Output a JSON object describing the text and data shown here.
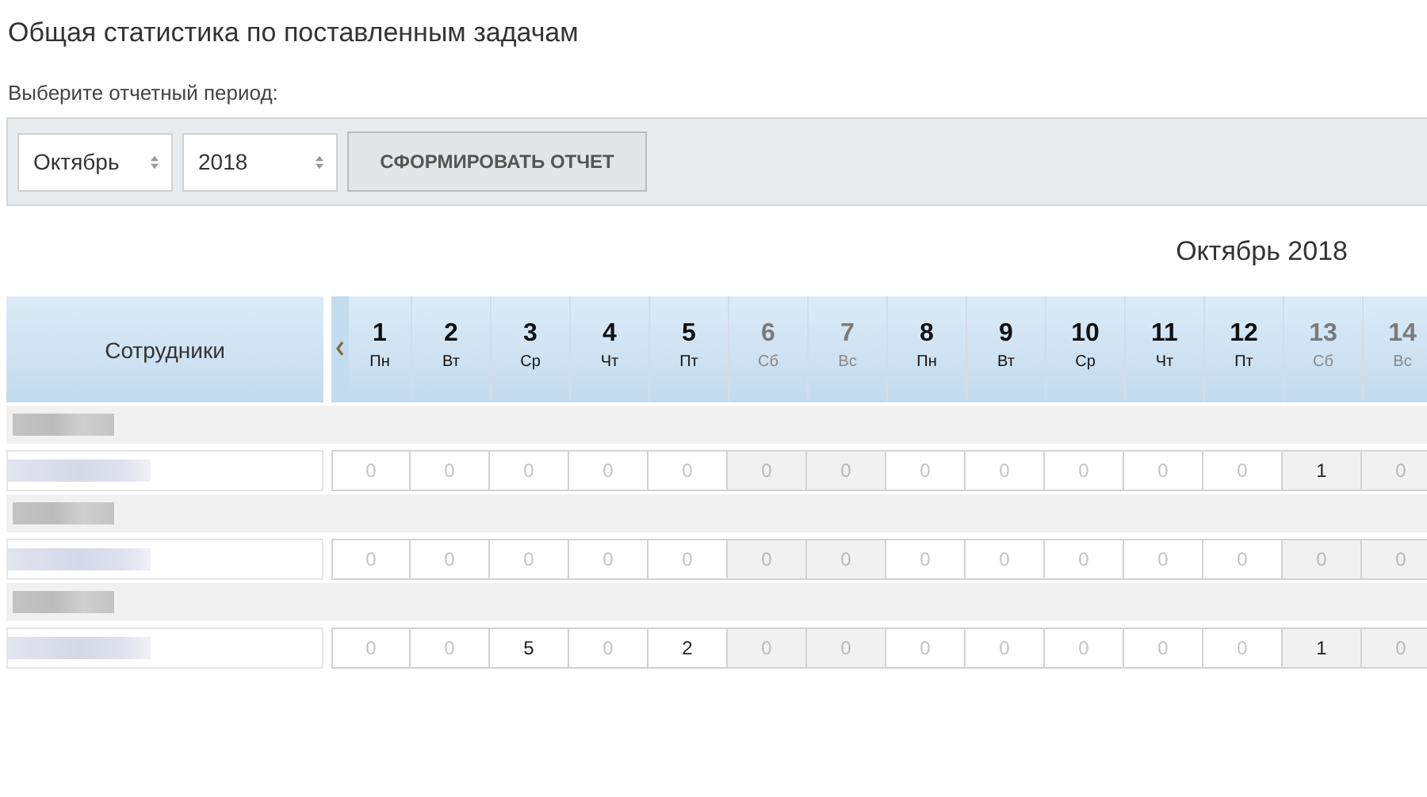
{
  "title": "Общая статистика по поставленным задачам",
  "period_label": "Выберите отчетный период:",
  "filters": {
    "month": {
      "value": "Октябрь"
    },
    "year": {
      "value": "2018"
    },
    "button": "СФОРМИРОВАТЬ ОТЧЕТ"
  },
  "caption": "Октябрь 2018",
  "table": {
    "employee_column": "Сотрудники",
    "days": [
      {
        "number": "1",
        "weekday": "Пн",
        "weekend": false
      },
      {
        "number": "2",
        "weekday": "Вт",
        "weekend": false
      },
      {
        "number": "3",
        "weekday": "Ср",
        "weekend": false
      },
      {
        "number": "4",
        "weekday": "Чт",
        "weekend": false
      },
      {
        "number": "5",
        "weekday": "Пт",
        "weekend": false
      },
      {
        "number": "6",
        "weekday": "Сб",
        "weekend": true
      },
      {
        "number": "7",
        "weekday": "Вс",
        "weekend": true
      },
      {
        "number": "8",
        "weekday": "Пн",
        "weekend": false
      },
      {
        "number": "9",
        "weekday": "Вт",
        "weekend": false
      },
      {
        "number": "10",
        "weekday": "Ср",
        "weekend": false
      },
      {
        "number": "11",
        "weekday": "Чт",
        "weekend": false
      },
      {
        "number": "12",
        "weekday": "Пт",
        "weekend": false
      },
      {
        "number": "13",
        "weekday": "Сб",
        "weekend": true
      },
      {
        "number": "14",
        "weekday": "Вс",
        "weekend": true
      }
    ],
    "rows": [
      {
        "cells": [
          {
            "value": "0",
            "muted": true
          },
          {
            "value": "0",
            "muted": true
          },
          {
            "value": "0",
            "muted": true
          },
          {
            "value": "0",
            "muted": true
          },
          {
            "value": "0",
            "muted": true
          },
          {
            "value": "0",
            "muted": true
          },
          {
            "value": "0",
            "muted": true
          },
          {
            "value": "0",
            "muted": true
          },
          {
            "value": "0",
            "muted": true
          },
          {
            "value": "0",
            "muted": true
          },
          {
            "value": "0",
            "muted": true
          },
          {
            "value": "0",
            "muted": true
          },
          {
            "value": "1",
            "muted": false
          },
          {
            "value": "0",
            "muted": true
          }
        ]
      },
      {
        "cells": [
          {
            "value": "0",
            "muted": true
          },
          {
            "value": "0",
            "muted": true
          },
          {
            "value": "0",
            "muted": true
          },
          {
            "value": "0",
            "muted": true
          },
          {
            "value": "0",
            "muted": true
          },
          {
            "value": "0",
            "muted": true
          },
          {
            "value": "0",
            "muted": true
          },
          {
            "value": "0",
            "muted": true
          },
          {
            "value": "0",
            "muted": true
          },
          {
            "value": "0",
            "muted": true
          },
          {
            "value": "0",
            "muted": true
          },
          {
            "value": "0",
            "muted": true
          },
          {
            "value": "0",
            "muted": true
          },
          {
            "value": "0",
            "muted": true
          }
        ]
      },
      {
        "cells": [
          {
            "value": "0",
            "muted": true
          },
          {
            "value": "0",
            "muted": true
          },
          {
            "value": "5",
            "muted": false
          },
          {
            "value": "0",
            "muted": true
          },
          {
            "value": "2",
            "muted": false
          },
          {
            "value": "0",
            "muted": true
          },
          {
            "value": "0",
            "muted": true
          },
          {
            "value": "0",
            "muted": true
          },
          {
            "value": "0",
            "muted": true
          },
          {
            "value": "0",
            "muted": true
          },
          {
            "value": "0",
            "muted": true
          },
          {
            "value": "0",
            "muted": true
          },
          {
            "value": "1",
            "muted": false
          },
          {
            "value": "0",
            "muted": true
          }
        ]
      }
    ]
  }
}
